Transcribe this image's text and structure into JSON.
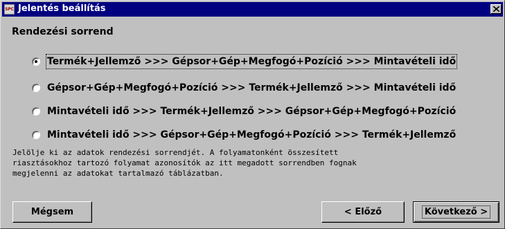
{
  "window": {
    "title": "Jelentés beállítás",
    "icon_text": "SPC",
    "close_icon": "close-icon"
  },
  "section": {
    "title": "Rendezési sorrend"
  },
  "options": [
    {
      "label": "Termék+Jellemző >>> Gépsor+Gép+Megfogó+Pozíció >>> Mintavételi idő",
      "selected": true
    },
    {
      "label": "Gépsor+Gép+Megfogó+Pozíció >>> Termék+Jellemző >>> Mintavételi idő",
      "selected": false
    },
    {
      "label": "Mintavételi idő >>> Termék+Jellemző >>> Gépsor+Gép+Megfogó+Pozíció",
      "selected": false
    },
    {
      "label": "Mintavételi idő >>> Gépsor+Gép+Megfogó+Pozíció >>> Termék+Jellemző",
      "selected": false
    }
  ],
  "help": {
    "lines": [
      "Jelölje ki az adatok rendezési sorrendjét. A folyamatonként összesített",
      "riasztásokhoz tartozó folyamat azonosítók az itt megadott sorrendben fognak",
      "megjelenni az adatokat tartalmazó táblázatban."
    ]
  },
  "buttons": {
    "cancel": "Mégsem",
    "previous": "< Előző",
    "next": "Következő >"
  },
  "colors": {
    "titlebar": "#000080",
    "face": "#c0c0c0"
  }
}
